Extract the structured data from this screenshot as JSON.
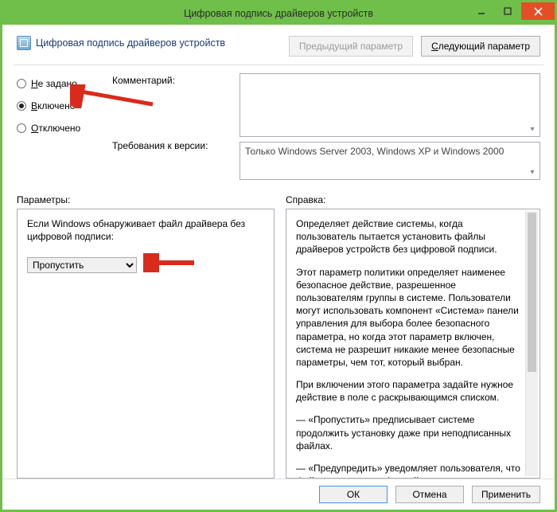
{
  "window": {
    "title": "Цифровая подпись драйверов устройств"
  },
  "header": {
    "title": "Цифровая подпись драйверов устройств",
    "prev": "Предыдущий параметр",
    "next_prefix": "С",
    "next_rest": "ледующий параметр"
  },
  "radios": {
    "notconf_prefix": "Н",
    "notconf_rest": "е задано",
    "enabled_prefix": "В",
    "enabled_rest": "ключено",
    "disabled_prefix": "О",
    "disabled_rest": "тключено",
    "selected": "enabled"
  },
  "comment_label": "Комментарий:",
  "comment_value": "",
  "version_label": "Требования к версии:",
  "version_value": "Только Windows Server 2003, Windows XP и Windows 2000",
  "params_label": "Параметры:",
  "help_label": "Справка:",
  "param_prompt": "Если Windows обнаруживает файл драйвера без цифровой подписи:",
  "param_selected": "Пропустить",
  "help": {
    "p1": "Определяет действие системы, когда пользователь пытается установить файлы драйверов устройств без цифровой подписи.",
    "p2": "Этот параметр политики определяет наименее безопасное действие, разрешенное пользователям группы в системе. Пользователи могут использовать компонент «Система» панели управления для выбора более безопасного параметра, но когда этот параметр включен, система не разрешит никакие менее безопасные параметры, чем тот, который выбран.",
    "p3": "При включении этого параметра задайте нужное действие в поле с раскрывающимся списком.",
    "p4": "— «Пропустить» предписывает системе продолжить установку даже при неподписанных файлах.",
    "p5": "— «Предупредить» уведомляет пользователя, что файлы не имеют цифровой подписи, и предоставляет пользователю"
  },
  "footer": {
    "ok": "ОК",
    "cancel": "Отмена",
    "apply": "Применить"
  }
}
